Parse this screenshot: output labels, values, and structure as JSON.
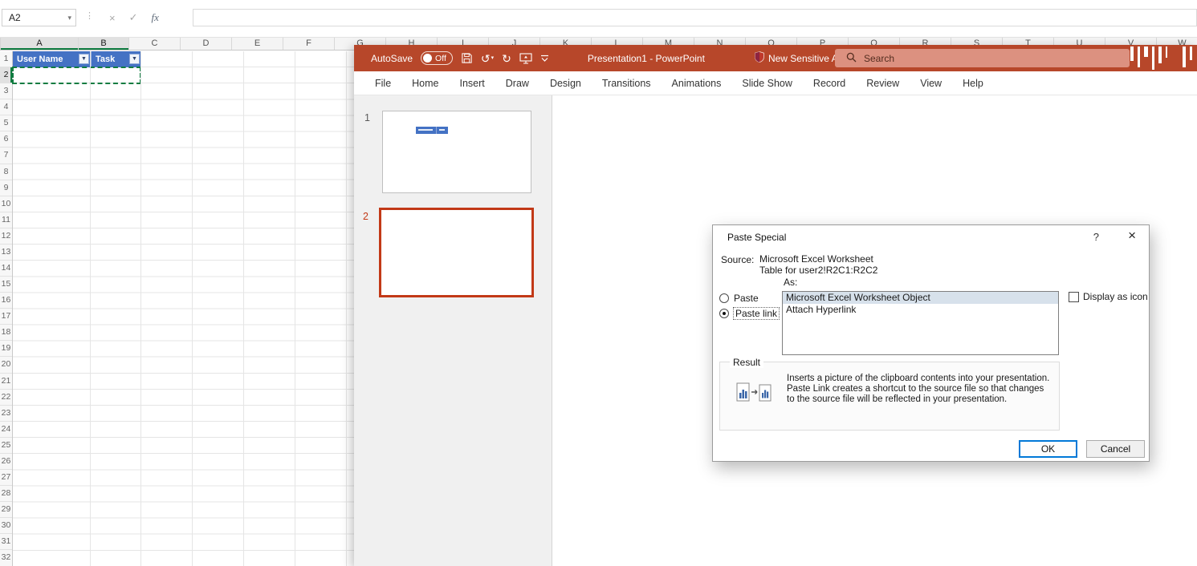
{
  "colors": {
    "ppt-red": "#B7472A",
    "search-bg": "#DC9180",
    "search-text": "#542D1F",
    "excel-blue": "#4472C4",
    "marquee-green": "#107C41",
    "slide-accent": "#C23917",
    "ok-border": "#0078D7",
    "list-sel": "#D7E1EB"
  },
  "glyphs": {
    "cancel": "×",
    "check": "✓",
    "fx": "fx",
    "chevron-down": "▾",
    "filter": "▼",
    "undo": "↺",
    "redo": "↻",
    "help": "?",
    "close": "×"
  },
  "excel": {
    "name_box": "A2",
    "formula_value": "",
    "column_headers": [
      "A",
      "B",
      "C",
      "D",
      "E",
      "F",
      "G",
      "H",
      "I",
      "J",
      "K",
      "L",
      "M",
      "N",
      "O",
      "P",
      "Q",
      "R",
      "S",
      "T",
      "U",
      "V",
      "W"
    ],
    "selected_columns": [
      "A",
      "B"
    ],
    "visible_rows": 32,
    "selected_row": 2,
    "table_headers": [
      "User Name",
      "Task"
    ]
  },
  "powerpoint": {
    "titlebar": {
      "autosave_label": "AutoSave",
      "autosave_state": "Off",
      "title": "Presentation1  -  PowerPoint",
      "sensitivity": "New Sensitive A*",
      "search_placeholder": "Search"
    },
    "menu": [
      "File",
      "Home",
      "Insert",
      "Draw",
      "Design",
      "Transitions",
      "Animations",
      "Slide Show",
      "Record",
      "Review",
      "View",
      "Help"
    ],
    "slides": [
      {
        "number": "1"
      },
      {
        "number": "2"
      }
    ]
  },
  "dialog": {
    "title": "Paste Special",
    "source_label": "Source:",
    "source_line1": "Microsoft Excel Worksheet",
    "source_line2": "Table for user2!R2C1:R2C2",
    "as_label": "As:",
    "paste_label": "Paste",
    "paste_link_label": "Paste link",
    "as_options": [
      "Microsoft Excel Worksheet Object",
      "Attach Hyperlink"
    ],
    "selected_option_index": 0,
    "display_as_icon_label": "Display as icon",
    "result_label": "Result",
    "result_text": "Inserts a picture of the clipboard contents into your presentation. Paste Link creates a shortcut to the source file so that changes to the source file will be reflected in your presentation.",
    "ok_label": "OK",
    "cancel_label": "Cancel"
  }
}
